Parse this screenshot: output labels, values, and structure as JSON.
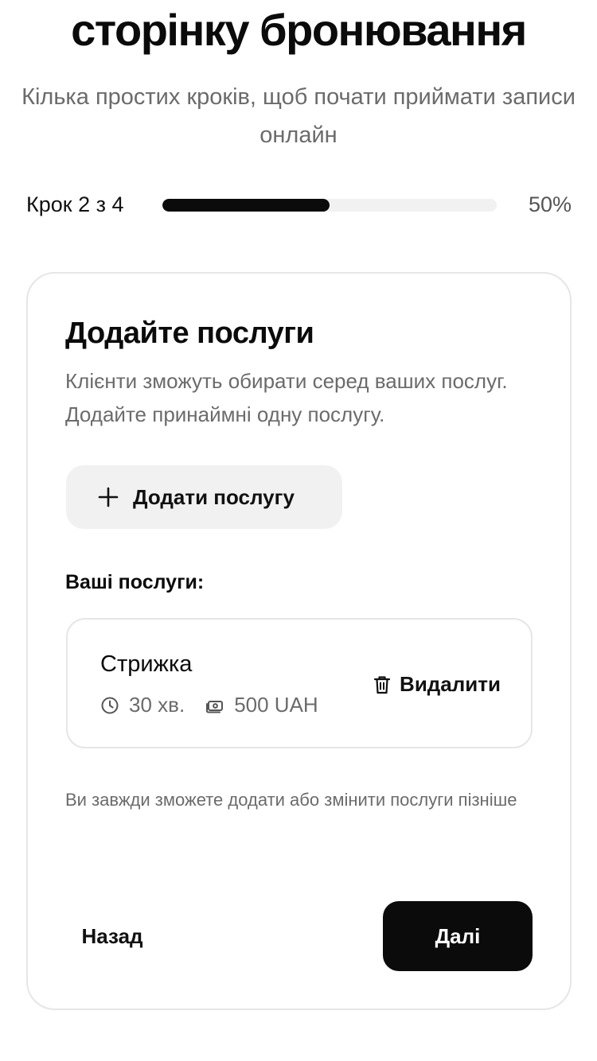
{
  "hero": {
    "title": "сторінку бронювання",
    "subtitle": "Кілька простих кроків, щоб почати приймати записи онлайн"
  },
  "progress": {
    "step_label": "Крок 2 з 4",
    "percent_label": "50%",
    "fraction": 0.5
  },
  "card": {
    "title": "Додайте послуги",
    "description": "Клієнти зможуть обирати серед ваших послуг. Додайте принаймні одну послугу.",
    "add_button_label": "Додати послугу",
    "services_heading": "Ваші послуги:",
    "services": [
      {
        "name": "Стрижка",
        "duration": "30 хв.",
        "price": "500 UAH",
        "delete_label": "Видалити"
      }
    ],
    "hint": "Ви завжди зможете додати або змінити послуги пізніше"
  },
  "footer": {
    "back_label": "Назад",
    "next_label": "Далі"
  },
  "colors": {
    "primary": "#0b0b0b",
    "muted_text": "#6b6b6b",
    "surface": "#f1f1f1",
    "border": "#e6e6e6"
  }
}
